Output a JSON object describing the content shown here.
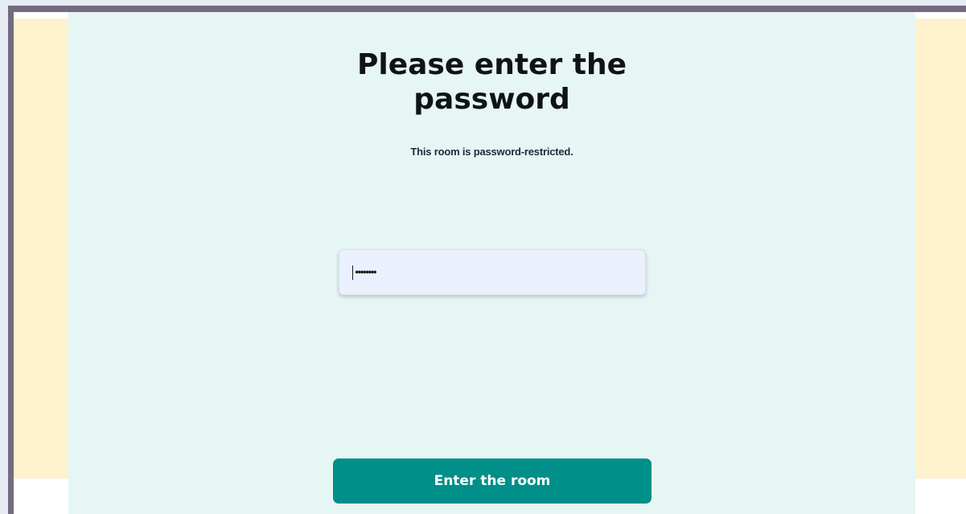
{
  "dialog": {
    "title_line1": "Please enter the",
    "title_line2": "password",
    "subtitle": "This room is password-restricted.",
    "password_value": "••••••••",
    "button_label": "Enter the room"
  },
  "colors": {
    "window_border": "#756b80",
    "page_background": "#fef1cd",
    "card_background": "#e6f6f4",
    "input_background": "#eaf0fd",
    "button_background": "#008f89",
    "button_text": "#ffffff"
  }
}
